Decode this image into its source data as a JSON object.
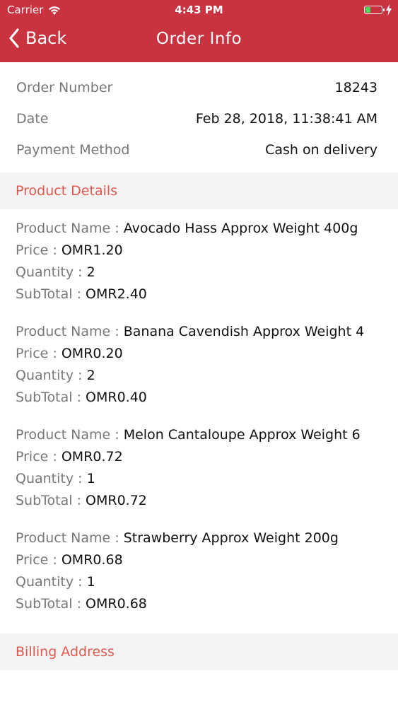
{
  "status_bar": {
    "carrier": "Carrier",
    "time": "4:43 PM",
    "battery_color": "#4cd964"
  },
  "nav": {
    "back_label": "Back",
    "title": "Order Info",
    "bar_color": "#c9323f"
  },
  "order": {
    "number_label": "Order Number",
    "number": "18243",
    "date_label": "Date",
    "date": "Feb 28, 2018, 11:38:41 AM",
    "payment_label": "Payment Method",
    "payment": "Cash on delivery"
  },
  "sections": {
    "product_details": "Product Details",
    "billing_address": "Billing Address",
    "accent_color": "#e0584e"
  },
  "product_labels": {
    "name": "Product Name : ",
    "price": "Price : ",
    "quantity": "Quantity : ",
    "subtotal": "SubTotal : "
  },
  "products": [
    {
      "name": "Avocado Hass Approx Weight 400g",
      "price": "OMR1.20",
      "quantity": "2",
      "subtotal": "OMR2.40"
    },
    {
      "name": "Banana Cavendish Approx Weight 4",
      "price": "OMR0.20",
      "quantity": "2",
      "subtotal": "OMR0.40"
    },
    {
      "name": "Melon Cantaloupe Approx Weight 6",
      "price": "OMR0.72",
      "quantity": "1",
      "subtotal": "OMR0.72"
    },
    {
      "name": "Strawberry Approx Weight 200g",
      "price": "OMR0.68",
      "quantity": "1",
      "subtotal": "OMR0.68"
    }
  ]
}
